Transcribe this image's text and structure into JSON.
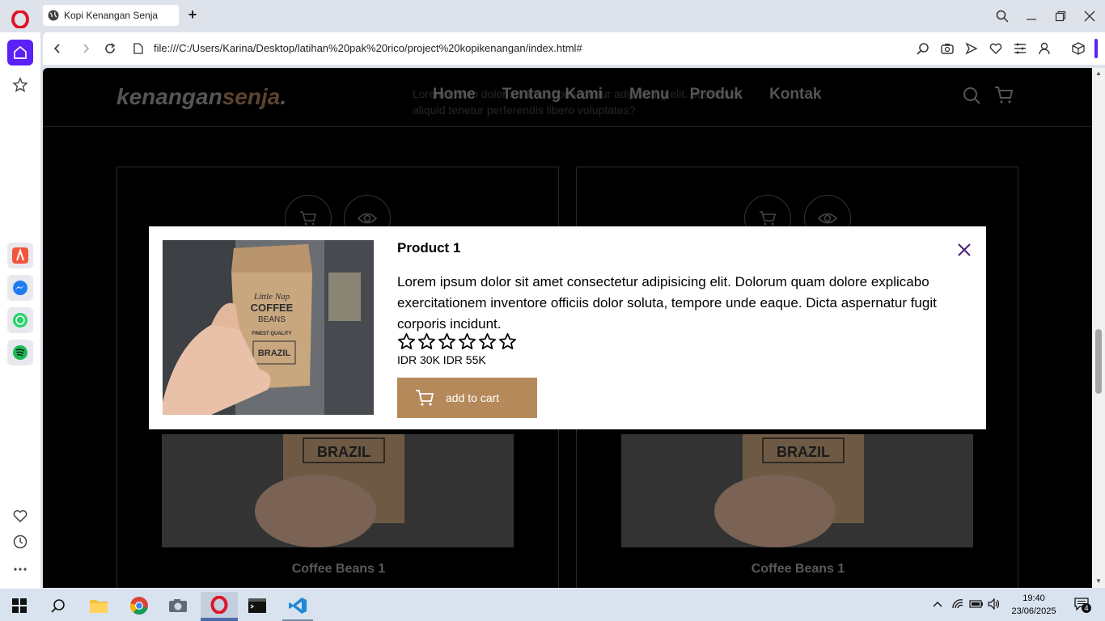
{
  "browser": {
    "tab_title": "Kopi Kenangan Senja",
    "url": "file:///C:/Users/Karina/Desktop/latihan%20pak%20rico/project%20kopikenangan/index.html#",
    "accent_color": "#5b21f6"
  },
  "site": {
    "logo_main": "kenangan",
    "logo_accent": "senja",
    "logo_dot": ".",
    "nav": [
      "Home",
      "Tentang Kami",
      "Menu",
      "Produk",
      "Kontak"
    ],
    "ghost_text": "Lorem ipsum dolor sit amet consectetur adipisicing elit. possimus, aliquid tenetur perferendis libero voluptates?"
  },
  "cards": [
    {
      "title": "Coffee Beans 1"
    },
    {
      "title": "Coffee Beans 1"
    }
  ],
  "modal": {
    "title": "Product 1",
    "description": "Lorem ipsum dolor sit amet consectetur adipisicing elit. Dolorum quam dolore explicabo exercitationem inventore officiis dolor soluta, tempore unde eaque. Dicta aspernatur fugit corporis incidunt.",
    "rating_max": 5,
    "price": "IDR 30K IDR 55K",
    "add_label": "add to cart",
    "button_color": "#b6895b",
    "bag_text": {
      "line1": "Little Nap",
      "line2": "COFFEE",
      "line3": "BEANS",
      "line4": "FINEST QUALITY",
      "line5": "BRAZIL"
    }
  },
  "taskbar": {
    "time": "19:40",
    "date": "23/06/2025",
    "notifications": "4"
  }
}
